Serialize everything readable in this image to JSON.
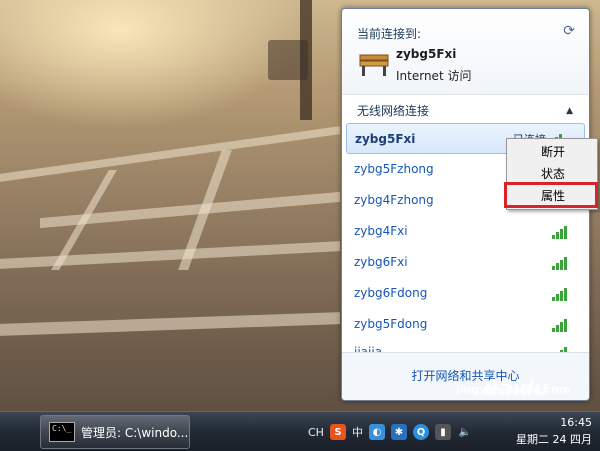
{
  "flyout": {
    "current_header": "当前连接到:",
    "current_ssid": "zybg5Fxi",
    "current_status": "Internet 访问",
    "wireless_header": "无线网络连接",
    "networks": [
      {
        "ssid": "zybg5Fxi",
        "status": "已连接",
        "signal_bars": 4,
        "selected": true
      },
      {
        "ssid": "zybg5Fzhong",
        "status": "",
        "signal_bars": 4,
        "selected": false
      },
      {
        "ssid": "zybg4Fzhong",
        "status": "",
        "signal_bars": 4,
        "selected": false
      },
      {
        "ssid": "zybg4Fxi",
        "status": "",
        "signal_bars": 4,
        "selected": false
      },
      {
        "ssid": "zybg6Fxi",
        "status": "",
        "signal_bars": 4,
        "selected": false
      },
      {
        "ssid": "zybg6Fdong",
        "status": "",
        "signal_bars": 4,
        "selected": false
      },
      {
        "ssid": "zybg5Fdong",
        "status": "",
        "signal_bars": 4,
        "selected": false
      },
      {
        "ssid": "jiajia",
        "status": "",
        "signal_bars": 4,
        "selected": false
      }
    ],
    "footer_link": "打开网络和共享中心"
  },
  "context_menu": {
    "items": [
      "断开",
      "状态",
      "属性"
    ],
    "highlighted": "属性"
  },
  "taskbar": {
    "task_label": "管理员: C:\\windo...",
    "tray_text": "CH",
    "tray_ime": "中",
    "clock_time": "16:45",
    "clock_date": "星期二 24 四月"
  },
  "watermark": {
    "brand": "Baidu",
    "url": "jingyan.baidu.com"
  },
  "colors": {
    "link": "#1557b8",
    "highlight": "#d9232b",
    "signal": "#3aa33a"
  }
}
